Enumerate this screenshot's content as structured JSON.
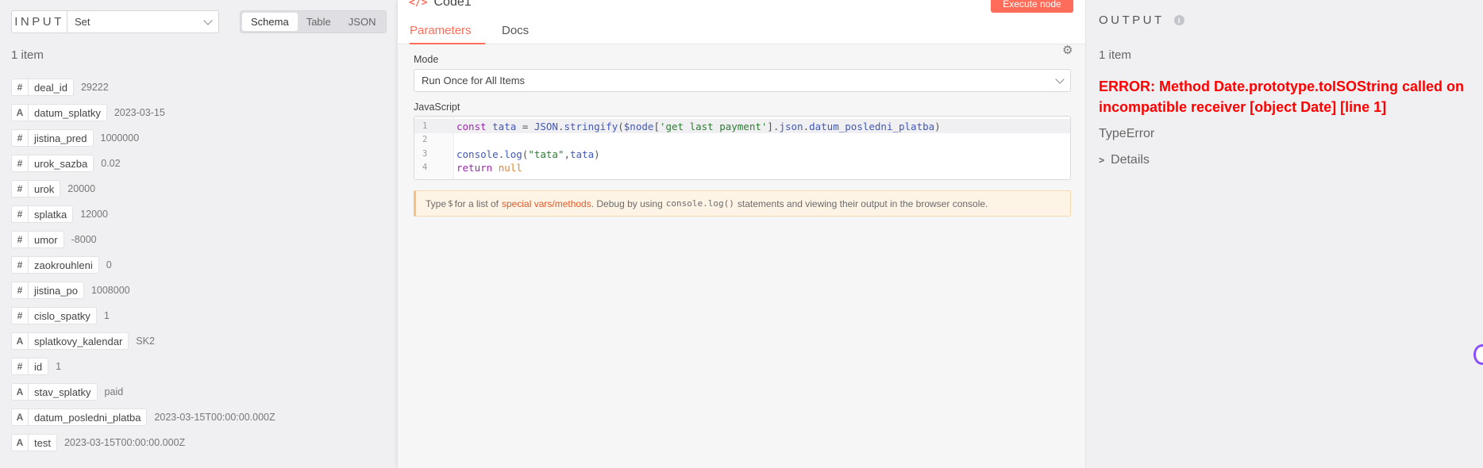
{
  "input_panel": {
    "label": "INPUT",
    "node_select": "Set",
    "views": [
      "Schema",
      "Table",
      "JSON"
    ],
    "active_view": "Schema",
    "item_count": "1 item",
    "fields": [
      {
        "type": "#",
        "name": "deal_id",
        "value": "29222"
      },
      {
        "type": "A",
        "name": "datum_splatky",
        "value": "2023-03-15"
      },
      {
        "type": "#",
        "name": "jistina_pred",
        "value": "1000000"
      },
      {
        "type": "#",
        "name": "urok_sazba",
        "value": "0.02"
      },
      {
        "type": "#",
        "name": "urok",
        "value": "20000"
      },
      {
        "type": "#",
        "name": "splatka",
        "value": "12000"
      },
      {
        "type": "#",
        "name": "umor",
        "value": "-8000"
      },
      {
        "type": "#",
        "name": "zaokrouhleni",
        "value": "0"
      },
      {
        "type": "#",
        "name": "jistina_po",
        "value": "1008000"
      },
      {
        "type": "#",
        "name": "cislo_spatky",
        "value": "1"
      },
      {
        "type": "A",
        "name": "splatkovy_kalendar",
        "value": "SK2"
      },
      {
        "type": "#",
        "name": "id",
        "value": "1"
      },
      {
        "type": "A",
        "name": "stav_splatky",
        "value": "paid"
      },
      {
        "type": "A",
        "name": "datum_posledni_platba",
        "value": "2023-03-15T00:00:00.000Z"
      },
      {
        "type": "A",
        "name": "test",
        "value": "2023-03-15T00:00:00.000Z"
      }
    ]
  },
  "node": {
    "icon": "</>",
    "title": "Code1",
    "execute_label": "Execute node",
    "tabs": [
      "Parameters",
      "Docs"
    ],
    "active_tab": "Parameters",
    "mode_label": "Mode",
    "mode_value": "Run Once for All Items",
    "js_label": "JavaScript",
    "code_lines": [
      {
        "num": "1",
        "tokens": [
          [
            "k",
            "const "
          ],
          [
            "v",
            "tata "
          ],
          [
            "t",
            "= "
          ],
          [
            "v",
            "JSON"
          ],
          [
            "t",
            "."
          ],
          [
            "v",
            "stringify"
          ],
          [
            "t",
            "("
          ],
          [
            "v",
            "$node"
          ],
          [
            "t",
            "["
          ],
          [
            "s",
            "'get last payment'"
          ],
          [
            "t",
            "]."
          ],
          [
            "v",
            "json"
          ],
          [
            "t",
            "."
          ],
          [
            "v",
            "datum_posledni_platba"
          ],
          [
            "t",
            ")"
          ]
        ]
      },
      {
        "num": "2",
        "tokens": []
      },
      {
        "num": "3",
        "tokens": [
          [
            "v",
            "console"
          ],
          [
            "t",
            "."
          ],
          [
            "v",
            "log"
          ],
          [
            "t",
            "("
          ],
          [
            "s",
            "\"tata\""
          ],
          [
            "t",
            ","
          ],
          [
            "v",
            "tata"
          ],
          [
            "t",
            ")"
          ]
        ]
      },
      {
        "num": "4",
        "tokens": [
          [
            "k",
            "return "
          ],
          [
            "n",
            "null"
          ]
        ]
      }
    ],
    "hint": {
      "p1": "Type ",
      "dollar": "$",
      "p2": " for a list of ",
      "link": "special vars/methods",
      "p3": ". Debug by using ",
      "code": "console.log()",
      "p4": " statements and viewing their output in the browser console."
    },
    "accent_color": "#ff6d5a"
  },
  "output_panel": {
    "label": "OUTPUT",
    "item_count": "1 item",
    "error_message": "ERROR: Method Date.prototype.toISOString called on incompatible receiver [object Date] [line 1]",
    "error_type": "TypeError",
    "details_label": "Details",
    "error_color": "#ff0000"
  }
}
